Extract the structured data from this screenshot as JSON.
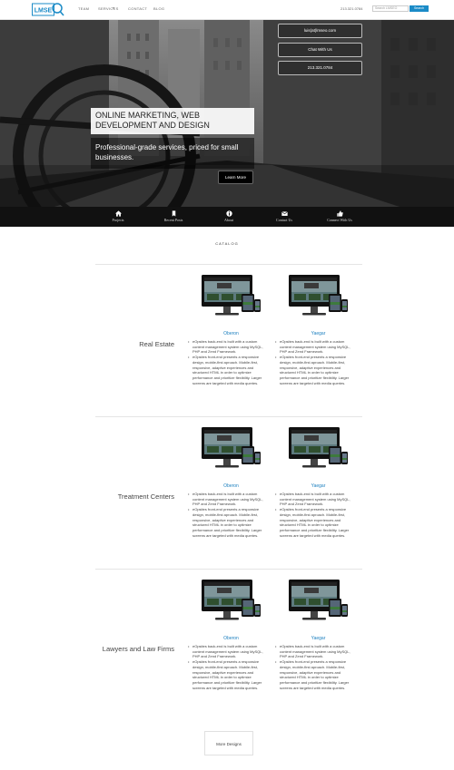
{
  "nav": {
    "logo_text": "LMSE",
    "items": [
      "TEAM",
      "SERVICES",
      "CONTACT",
      "BLOG"
    ],
    "services_caret": "▾",
    "phone": "213.321.0784",
    "search_placeholder": "Search LMSEO",
    "search_label": "Search"
  },
  "hero": {
    "email_label": "luis(at)lmseo.com",
    "chat_label": "Chat With Us",
    "phone_label": "213.321.0784",
    "headline": "ONLINE MARKETING, WEB DEVELOPMENT AND DESIGN",
    "subline": "Professional-grade services, priced for small businesses.",
    "learn_more": "Learn More"
  },
  "iconbar": [
    {
      "label": "Projects",
      "icon": "home-icon"
    },
    {
      "label": "Recent Posts",
      "icon": "bookmark-icon"
    },
    {
      "label": "About",
      "icon": "info-icon"
    },
    {
      "label": "Contact Us",
      "icon": "mail-icon"
    },
    {
      "label": "Connect With Us",
      "icon": "thumbs-up-icon"
    }
  ],
  "catalog": {
    "heading": "CATALOG",
    "categories": [
      {
        "name": "Real Estate",
        "projects": [
          {
            "title": "Oberon",
            "bullets": [
              "eOpsites back-end is built with a custom content management system using MySQL, PHP and Zend Framework.",
              "eOpsites front-end presents a responsive design, mobile-first aproach. Mobile-first, responsive, adaptive experiences and structured HTML in order to optimize performance and prioritize flexibility. Larger screens are targeted with media queries."
            ]
          },
          {
            "title": "Yaegar",
            "bullets": [
              "eOpsites back-end is built with a custom content management system using MySQL, PHP and Zend Framework.",
              "eOpsites front-end presents a responsive design, mobile-first aproach. Mobile-first, responsive, adaptive experiences and structured HTML in order to optimize performance and prioritize flexibility. Larger screens are targeted with media queries."
            ]
          }
        ]
      },
      {
        "name": "Treatment Centers",
        "projects": [
          {
            "title": "Oberon",
            "bullets": [
              "eOpsites back-end is built with a custom content management system using MySQL, PHP and Zend Framework.",
              "eOpsites front-end presents a responsive design, mobile-first aproach. Mobile-first, responsive, adaptive experiences and structured HTML in order to optimize performance and prioritize flexibility. Larger screens are targeted with media queries."
            ]
          },
          {
            "title": "Yaegar",
            "bullets": [
              "eOpsites back-end is built with a custom content management system using MySQL, PHP and Zend Framework.",
              "eOpsites front-end presents a responsive design, mobile-first aproach. Mobile-first, responsive, adaptive experiences and structured HTML in order to optimize performance and prioritize flexibility. Larger screens are targeted with media queries."
            ]
          }
        ]
      },
      {
        "name": "Lawyers and Law Firms",
        "projects": [
          {
            "title": "Oberon",
            "bullets": [
              "eOpsites back-end is built with a custom content management system using MySQL, PHP and Zend Framework.",
              "eOpsites front-end presents a responsive design, mobile-first aproach. Mobile-first, responsive, adaptive experiences and structured HTML in order to optimize performance and prioritize flexibility. Larger screens are targeted with media queries."
            ]
          },
          {
            "title": "Yaegar",
            "bullets": [
              "eOpsites back-end is built with a custom content management system using MySQL, PHP and Zend Framework.",
              "eOpsites front-end presents a responsive design, mobile-first aproach. Mobile-first, responsive, adaptive experiences and structured HTML in order to optimize performance and prioritize flexibility. Larger screens are targeted with media queries."
            ]
          }
        ]
      }
    ],
    "more_label": "More Designs"
  },
  "colors": {
    "accent": "#1b8bc7",
    "link": "#1b7fbf",
    "iconbar": "#111111"
  }
}
